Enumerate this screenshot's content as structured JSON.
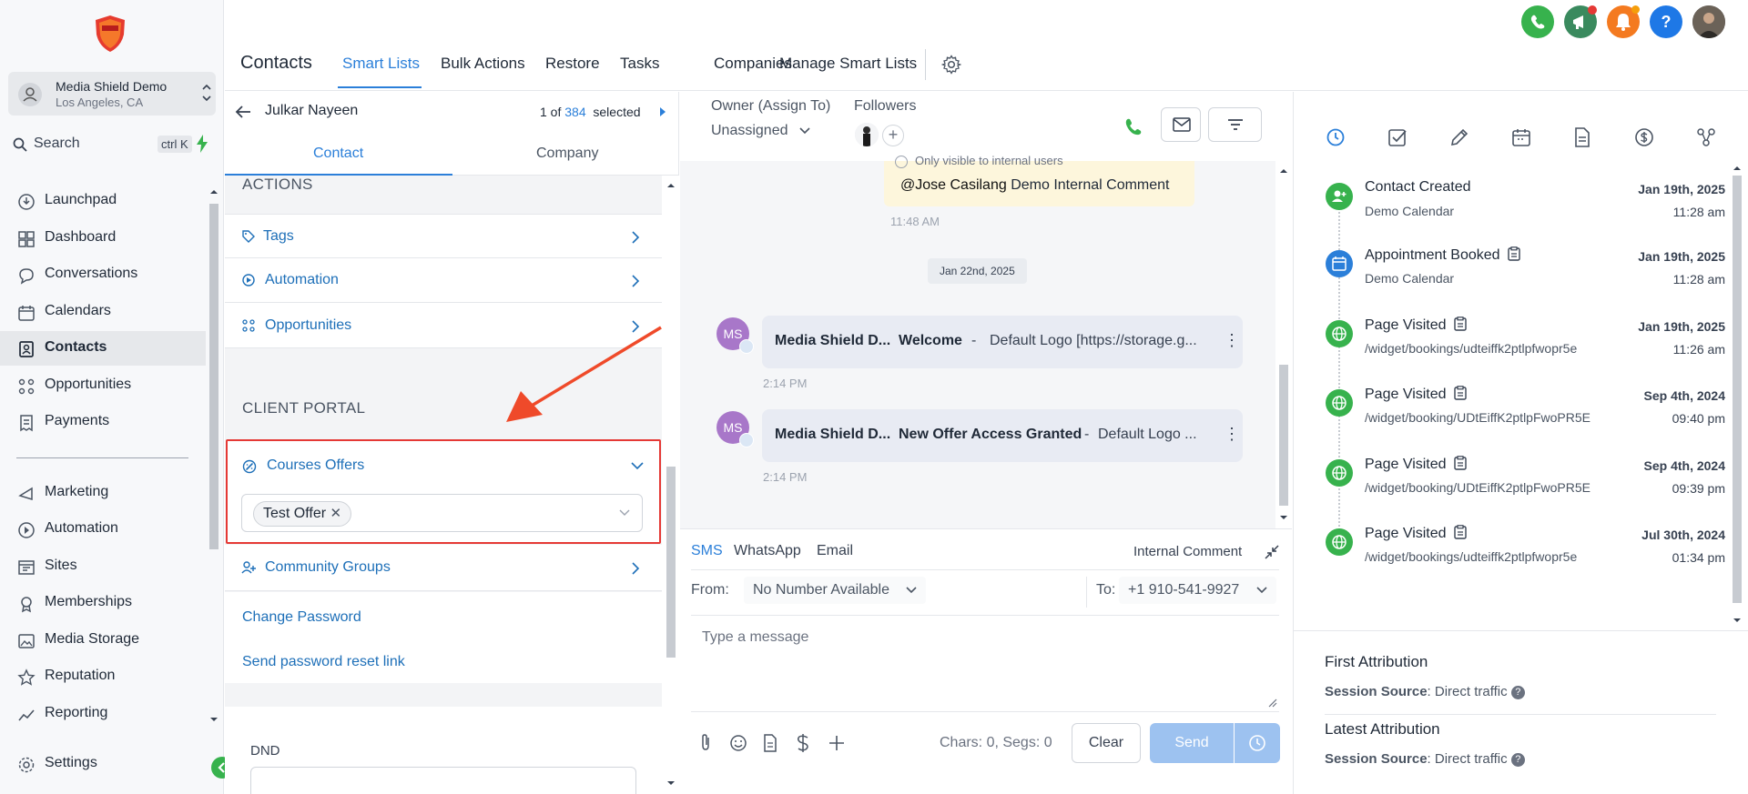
{
  "sidebar": {
    "account_name": "Media Shield Demo",
    "account_location": "Los Angeles, CA",
    "search_label": "Search",
    "search_shortcut": "ctrl K",
    "nav": [
      {
        "label": "Launchpad",
        "icon": "launchpad-icon"
      },
      {
        "label": "Dashboard",
        "icon": "dashboard-icon"
      },
      {
        "label": "Conversations",
        "icon": "chat-icon"
      },
      {
        "label": "Calendars",
        "icon": "calendar-icon"
      },
      {
        "label": "Contacts",
        "icon": "contacts-icon",
        "active": true
      },
      {
        "label": "Opportunities",
        "icon": "opportunities-icon"
      },
      {
        "label": "Payments",
        "icon": "payments-icon"
      },
      {
        "label": "Marketing",
        "icon": "marketing-icon"
      },
      {
        "label": "Automation",
        "icon": "automation-icon"
      },
      {
        "label": "Sites",
        "icon": "sites-icon"
      },
      {
        "label": "Memberships",
        "icon": "memberships-icon"
      },
      {
        "label": "Media Storage",
        "icon": "media-icon"
      },
      {
        "label": "Reputation",
        "icon": "star-icon"
      },
      {
        "label": "Reporting",
        "icon": "reporting-icon"
      },
      {
        "label": "Settings",
        "icon": "gear-icon"
      }
    ]
  },
  "topnav": {
    "title": "Contacts",
    "tabs": [
      "Smart Lists",
      "Bulk Actions",
      "Restore",
      "Tasks",
      "Companies",
      "Manage Smart Lists"
    ],
    "active_tab": "Smart Lists"
  },
  "contact": {
    "name": "Julkar Nayeen",
    "count_prefix": "1 of",
    "count_total": "384",
    "count_suffix": "selected",
    "tabs": [
      "Contact",
      "Company"
    ],
    "actions_heading": "ACTIONS",
    "action_rows": [
      "Tags",
      "Automation",
      "Opportunities"
    ],
    "client_portal_heading": "CLIENT PORTAL",
    "courses_offers_label": "Courses Offers",
    "courses_offers_tag": "Test Offer",
    "community_groups_label": "Community Groups",
    "change_password": "Change Password",
    "reset_link": "Send password reset link",
    "dnd_label": "DND"
  },
  "conversation": {
    "owner_label": "Owner (Assign To)",
    "owner_value": "Unassigned",
    "followers_label": "Followers",
    "internal_note_hint": "Only visible to internal users",
    "internal_note_mention": "@Jose Casilang",
    "internal_note_text": "Demo Internal Comment",
    "internal_note_time": "11:48 AM",
    "date_divider": "Jan 22nd, 2025",
    "messages": [
      {
        "avatar": "MS",
        "from": "Media Shield D...",
        "subject": "Welcome",
        "sep": "-",
        "body": "Default Logo [https://storage.g...",
        "time": "2:14 PM"
      },
      {
        "avatar": "MS",
        "from": "Media Shield D...",
        "subject": "New Offer Access Granted",
        "sep": "-",
        "body": "Default Logo ...",
        "time": "2:14 PM"
      }
    ],
    "composer": {
      "channels": [
        "SMS",
        "WhatsApp",
        "Email"
      ],
      "active_channel": "SMS",
      "internal_comment": "Internal Comment",
      "from_label": "From:",
      "from_value": "No Number Available",
      "to_label": "To:",
      "to_value": "+1 910-541-9927",
      "placeholder": "Type a message",
      "counter": "Chars: 0, Segs: 0",
      "clear_label": "Clear",
      "send_label": "Send"
    }
  },
  "timeline": {
    "events": [
      {
        "title": "Contact Created",
        "sub": "Demo Calendar",
        "date": "Jan 19th, 2025",
        "time": "11:28 am",
        "color": "#37b24d",
        "icon": "user-plus-icon",
        "clip": false
      },
      {
        "title": "Appointment Booked",
        "sub": "Demo Calendar",
        "date": "Jan 19th, 2025",
        "time": "11:28 am",
        "color": "#2b7fd9",
        "icon": "calendar-icon",
        "clip": true
      },
      {
        "title": "Page Visited",
        "sub": "/widget/bookings/udteiffk2ptlpfwopr5e",
        "date": "Jan 19th, 2025",
        "time": "11:26 am",
        "color": "#37b24d",
        "icon": "globe-icon",
        "clip": true
      },
      {
        "title": "Page Visited",
        "sub": "/widget/booking/UDtEiffK2ptlpFwoPR5E",
        "date": "Sep 4th, 2024",
        "time": "09:40 pm",
        "color": "#37b24d",
        "icon": "globe-icon",
        "clip": true
      },
      {
        "title": "Page Visited",
        "sub": "/widget/booking/UDtEiffK2ptlpFwoPR5E",
        "date": "Sep 4th, 2024",
        "time": "09:39 pm",
        "color": "#37b24d",
        "icon": "globe-icon",
        "clip": true
      },
      {
        "title": "Page Visited",
        "sub": "/widget/bookings/udteiffk2ptlpfwopr5e",
        "date": "Jul 30th, 2024",
        "time": "01:34 pm",
        "color": "#37b24d",
        "icon": "globe-icon",
        "clip": true
      }
    ]
  },
  "attribution": {
    "first_title": "First Attribution",
    "latest_title": "Latest Attribution",
    "source_label": "Session Source",
    "first_value": ": Direct traffic",
    "latest_value": ": Direct traffic"
  },
  "colors": {
    "accent": "#2b7fd9",
    "green": "#37b24d",
    "highlight_border": "#e53935",
    "arrow": "#ef4a2a"
  }
}
